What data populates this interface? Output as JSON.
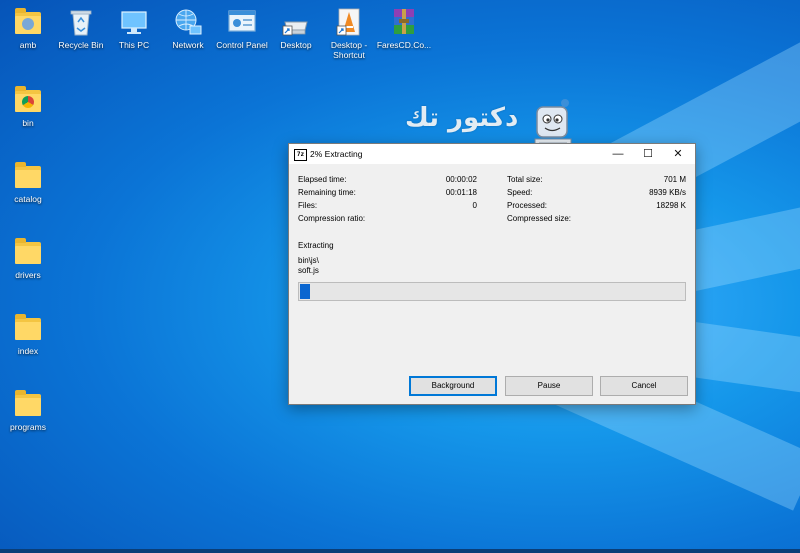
{
  "desktop": {
    "icons": [
      {
        "label": "amb",
        "icon": "user-folder-icon"
      },
      {
        "label": "Recycle Bin",
        "icon": "recycle-bin-icon"
      },
      {
        "label": "This PC",
        "icon": "this-pc-icon"
      },
      {
        "label": "Network",
        "icon": "network-icon"
      },
      {
        "label": "Control Panel",
        "icon": "control-panel-icon"
      },
      {
        "label": "Desktop",
        "icon": "desktop-drive-icon"
      },
      {
        "label": "Desktop - Shortcut",
        "icon": "shortcut-icon"
      },
      {
        "label": "FaresCD.Co...",
        "icon": "winrar-icon"
      },
      {
        "label": "bin",
        "icon": "chrome-folder-icon"
      },
      {
        "label": "catalog",
        "icon": "folder-icon"
      },
      {
        "label": "drivers",
        "icon": "folder-icon"
      },
      {
        "label": "index",
        "icon": "folder-icon"
      },
      {
        "label": "programs",
        "icon": "folder-icon"
      }
    ],
    "watermark_text": "دكتور تك"
  },
  "dialog": {
    "title": "2% Extracting",
    "app_icon_text": "7z",
    "window_controls": {
      "minimize": "—",
      "maximize": "☐",
      "close": "✕"
    },
    "stats_left": [
      {
        "label": "Elapsed time:",
        "value": "00:00:02"
      },
      {
        "label": "Remaining time:",
        "value": "00:01:18"
      },
      {
        "label": "Files:",
        "value": "0"
      },
      {
        "label": "Compression ratio:",
        "value": ""
      }
    ],
    "stats_right": [
      {
        "label": "Total size:",
        "value": "701 M"
      },
      {
        "label": "Speed:",
        "value": "8939 KB/s"
      },
      {
        "label": "Processed:",
        "value": "18298 K"
      },
      {
        "label": "Compressed size:",
        "value": ""
      }
    ],
    "operation": "Extracting",
    "current_path": "bin\\js\\",
    "current_file": "soft.js",
    "progress_percent": 2,
    "buttons": {
      "background": "Background",
      "pause": "Pause",
      "cancel": "Cancel"
    }
  },
  "colors": {
    "desktop_blue": "#0b74d6",
    "progress": "#0a66d0",
    "folder": "#ffd866"
  }
}
